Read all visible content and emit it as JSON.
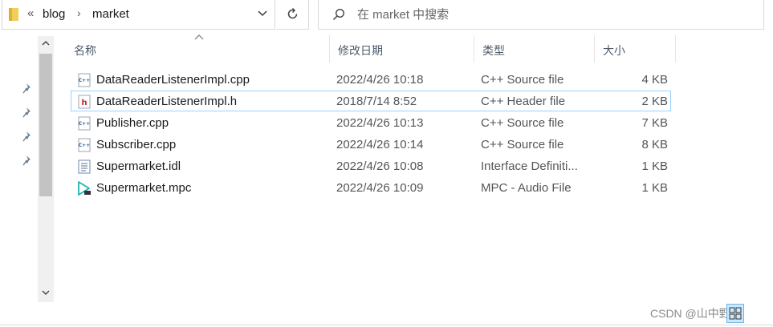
{
  "address_bar": {
    "overflow_chevron": "«",
    "crumbs": [
      "blog",
      "market"
    ],
    "separator": "›",
    "icon": "folder-icon",
    "dropdown_icon": "chevron-down-icon"
  },
  "refresh": {
    "icon": "refresh-icon"
  },
  "search": {
    "placeholder": "在 market 中搜索",
    "icon": "search-icon"
  },
  "columns": {
    "name": "名称",
    "date": "修改日期",
    "type": "类型",
    "size": "大小"
  },
  "files": [
    {
      "name": "DataReaderListenerImpl.cpp",
      "date": "2022/4/26 10:18",
      "type": "C++ Source file",
      "size": "4 KB",
      "icon": "cpp-file-icon"
    },
    {
      "name": "DataReaderListenerImpl.h",
      "date": "2018/7/14 8:52",
      "type": "C++ Header file",
      "size": "2 KB",
      "icon": "header-file-icon",
      "selected": true
    },
    {
      "name": "Publisher.cpp",
      "date": "2022/4/26 10:13",
      "type": "C++ Source file",
      "size": "7 KB",
      "icon": "cpp-file-icon"
    },
    {
      "name": "Subscriber.cpp",
      "date": "2022/4/26 10:14",
      "type": "C++ Source file",
      "size": "8 KB",
      "icon": "cpp-file-icon"
    },
    {
      "name": "Supermarket.idl",
      "date": "2022/4/26 10:08",
      "type": "Interface Definiti...",
      "size": "1 KB",
      "icon": "text-file-icon"
    },
    {
      "name": "Supermarket.mpc",
      "date": "2022/4/26 10:09",
      "type": "MPC - Audio File",
      "size": "1 KB",
      "icon": "audio-file-icon"
    }
  ],
  "watermark": "CSDN @山中野竹",
  "colors": {
    "selection_border": "#99d1ff",
    "view_button": "#cce8ff"
  }
}
